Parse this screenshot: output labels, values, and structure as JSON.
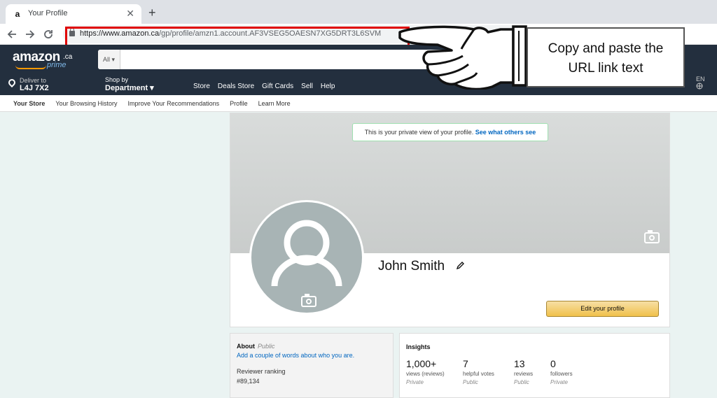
{
  "browser": {
    "tab_title": "Your Profile",
    "favicon": "a",
    "close_symbol": "✕",
    "new_tab_symbol": "+",
    "url_host": "https://www.amazon.ca",
    "url_path": "/gp/profile/amzn1.account.AF3VSEG5OAESN7XG5DRT3L6SVM",
    "icons": [
      "back-icon",
      "forward-icon",
      "reload-icon",
      "lock-icon"
    ]
  },
  "amazon_header": {
    "logo_text": "amazon",
    "logo_ca": ".ca",
    "logo_prime": "prime",
    "search_category": "All ▾",
    "deliver_label": "Deliver to",
    "deliver_postal": "L4J 7X2",
    "shop_by": "Shop by",
    "department": "Department ▾",
    "nav_links": [
      "Store",
      "Deals Store",
      "Gift Cards",
      "Sell",
      "Help"
    ],
    "lang": "EN"
  },
  "subnav": [
    "Your Store",
    "Your Browsing History",
    "Improve Your Recommendations",
    "Profile",
    "Learn More"
  ],
  "profile": {
    "private_note": "This is your private view of your profile.",
    "private_link": "See what others see",
    "name": "John Smith",
    "edit_button": "Edit your profile"
  },
  "about": {
    "heading": "About",
    "visibility": "Public",
    "add_link": "Add a couple of words about who you are.",
    "ranking_label": "Reviewer ranking",
    "ranking_value": "#89,134"
  },
  "insights": {
    "heading": "Insights",
    "stats": [
      {
        "value": "1,000+",
        "label": "views (reviews)",
        "privacy": "Private"
      },
      {
        "value": "7",
        "label": "helpful votes",
        "privacy": "Public"
      },
      {
        "value": "13",
        "label": "reviews",
        "privacy": "Public"
      },
      {
        "value": "0",
        "label": "followers",
        "privacy": "Private"
      }
    ]
  },
  "callout": {
    "line1": "Copy and paste the",
    "line2": "URL link text"
  },
  "colors": {
    "highlight_box": "#e00000",
    "amazon_navy": "#232f3e",
    "button_yellow": "#f0c14b",
    "link_blue": "#0066c0"
  }
}
